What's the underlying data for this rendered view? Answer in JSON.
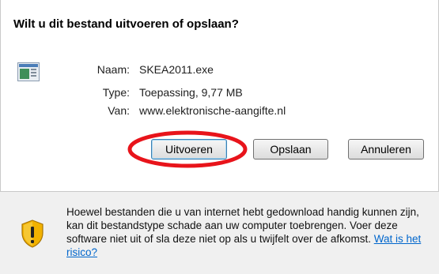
{
  "dialog": {
    "title": "Wilt u dit bestand uitvoeren of opslaan?",
    "file": {
      "icon": "executable-file-icon",
      "name_label": "Naam:",
      "name_value": "SKEA2011.exe",
      "type_label": "Type:",
      "type_value": "Toepassing, 9,77 MB",
      "from_label": "Van:",
      "from_value": "www.elektronische-aangifte.nl"
    },
    "buttons": {
      "run": "Uitvoeren",
      "save": "Opslaan",
      "cancel": "Annuleren"
    },
    "warning": {
      "icon": "security-shield-icon",
      "text": "Hoewel bestanden die u van internet hebt gedownload handig kunnen zijn, kan dit bestandstype schade aan uw computer toebrengen. Voer deze software niet uit of sla deze niet op als u twijfelt over de afkomst.",
      "link": "Wat is het risico?"
    }
  },
  "colors": {
    "highlight": "#e8141b",
    "link": "#0066cc",
    "pane": "#ffffff",
    "footer": "#f0f0f0"
  }
}
